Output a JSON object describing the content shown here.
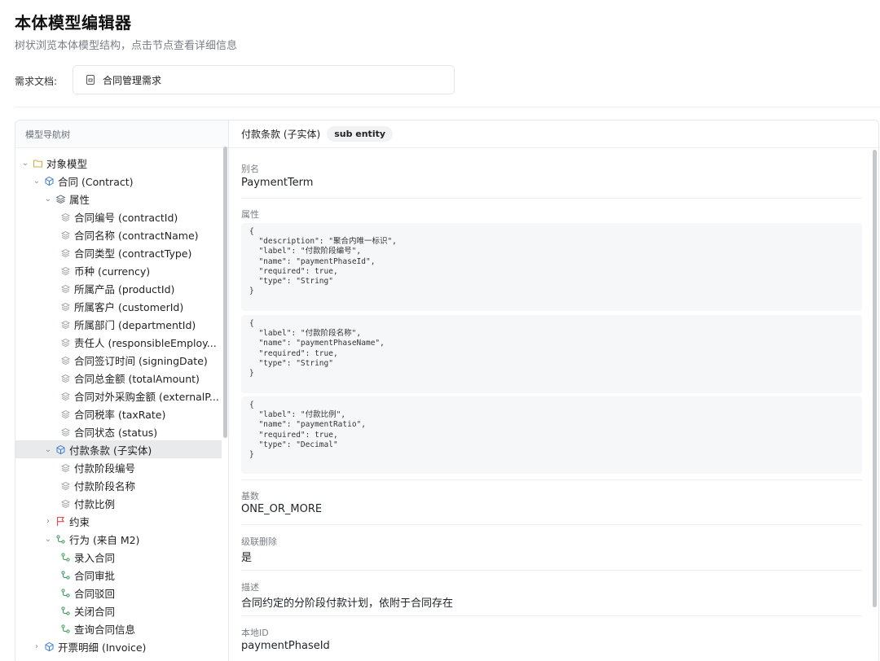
{
  "header": {
    "title": "本体模型编辑器",
    "subtitle": "树状浏览本体模型结构，点击节点查看详细信息"
  },
  "requirement": {
    "label": "需求文档:",
    "doc_name": "合同管理需求"
  },
  "tree_panel": {
    "title": "模型导航树",
    "nodes": [
      {
        "label": "对象模型",
        "chevron": "⌄",
        "icon": "folder-icon",
        "level": 0
      },
      {
        "label": "合同 (Contract)",
        "chevron": "⌄",
        "icon": "entity-icon",
        "level": 1
      },
      {
        "label": "属性",
        "chevron": "⌄",
        "icon": "layers-icon",
        "level": 2
      },
      {
        "label": "合同编号 (contractId)",
        "chevron": "",
        "icon": "attribute-icon",
        "level": 3
      },
      {
        "label": "合同名称 (contractName)",
        "chevron": "",
        "icon": "attribute-icon",
        "level": 3
      },
      {
        "label": "合同类型 (contractType)",
        "chevron": "",
        "icon": "attribute-icon",
        "level": 3
      },
      {
        "label": "币种 (currency)",
        "chevron": "",
        "icon": "attribute-icon",
        "level": 3
      },
      {
        "label": "所属产品 (productId)",
        "chevron": "",
        "icon": "attribute-icon",
        "level": 3
      },
      {
        "label": "所属客户 (customerId)",
        "chevron": "",
        "icon": "attribute-icon",
        "level": 3
      },
      {
        "label": "所属部门 (departmentId)",
        "chevron": "",
        "icon": "attribute-icon",
        "level": 3
      },
      {
        "label": "责任人 (responsibleEmploy...",
        "chevron": "",
        "icon": "attribute-icon",
        "level": 3
      },
      {
        "label": "合同签订时间 (signingDate)",
        "chevron": "",
        "icon": "attribute-icon",
        "level": 3
      },
      {
        "label": "合同总金额 (totalAmount)",
        "chevron": "",
        "icon": "attribute-icon",
        "level": 3
      },
      {
        "label": "合同对外采购金额 (externalP...",
        "chevron": "",
        "icon": "attribute-icon",
        "level": 3
      },
      {
        "label": "合同税率 (taxRate)",
        "chevron": "",
        "icon": "attribute-icon",
        "level": 3
      },
      {
        "label": "合同状态 (status)",
        "chevron": "",
        "icon": "attribute-icon",
        "level": 3
      },
      {
        "label": "付款条款 (子实体)",
        "chevron": "⌄",
        "icon": "entity-icon",
        "level": 2,
        "selected": true
      },
      {
        "label": "付款阶段编号",
        "chevron": "",
        "icon": "attribute-icon",
        "level": 3
      },
      {
        "label": "付款阶段名称",
        "chevron": "",
        "icon": "attribute-icon",
        "level": 3
      },
      {
        "label": "付款比例",
        "chevron": "",
        "icon": "attribute-icon",
        "level": 3
      },
      {
        "label": "约束",
        "chevron": "›",
        "icon": "flag-icon",
        "level": 2
      },
      {
        "label": "行为 (来自 M2)",
        "chevron": "⌄",
        "icon": "behavior-icon",
        "level": 2
      },
      {
        "label": "录入合同",
        "chevron": "",
        "icon": "behavior-icon",
        "level": 3
      },
      {
        "label": "合同审批",
        "chevron": "",
        "icon": "behavior-icon",
        "level": 3
      },
      {
        "label": "合同驳回",
        "chevron": "",
        "icon": "behavior-icon",
        "level": 3
      },
      {
        "label": "关闭合同",
        "chevron": "",
        "icon": "behavior-icon",
        "level": 3
      },
      {
        "label": "查询合同信息",
        "chevron": "",
        "icon": "behavior-icon",
        "level": 3
      },
      {
        "label": "开票明细 (Invoice)",
        "chevron": "›",
        "icon": "entity-icon",
        "level": 1
      }
    ]
  },
  "detail_panel": {
    "title": "付款条款 (子实体)",
    "badge": "sub entity",
    "alias_label": "别名",
    "alias_value": "PaymentTerm",
    "attributes_label": "属性",
    "attribute_blocks": [
      "{\n  \"description\": \"聚合内唯一标识\",\n  \"label\": \"付款阶段编号\",\n  \"name\": \"paymentPhaseId\",\n  \"required\": true,\n  \"type\": \"String\"\n}",
      "{\n  \"label\": \"付款阶段名称\",\n  \"name\": \"paymentPhaseName\",\n  \"required\": true,\n  \"type\": \"String\"\n}",
      "{\n  \"label\": \"付款比例\",\n  \"name\": \"paymentRatio\",\n  \"required\": true,\n  \"type\": \"Decimal\"\n}"
    ],
    "cardinality_label": "基数",
    "cardinality_value": "ONE_OR_MORE",
    "cascade_label": "级联删除",
    "cascade_value": "是",
    "description_label": "描述",
    "description_value": "合同约定的分阶段付款计划，依附于合同存在",
    "local_id_label": "本地ID",
    "local_id_value": "paymentPhaseId"
  },
  "colors": {
    "entity": "#3a7bd5",
    "folder": "#d9a83c",
    "attribute": "#9aa0a6",
    "flag": "#e5484d",
    "behavior": "#3a9a5a",
    "selected_bg": "#e9eaec"
  }
}
